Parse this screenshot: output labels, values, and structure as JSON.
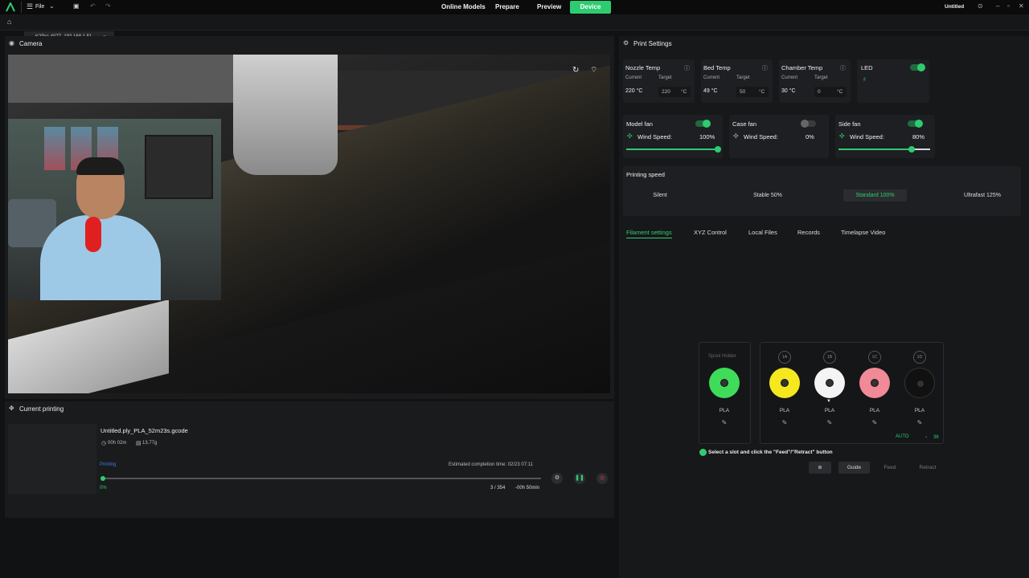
{
  "titlebar": {
    "menu_file": "File",
    "menus": [
      "Online Models",
      "Prepare",
      "Preview"
    ],
    "device": "Device",
    "project_name": "Untitled"
  },
  "tabbar": {
    "file_tab": "K2Pro-4077_192.168.1.51"
  },
  "camera": {
    "title": "Camera"
  },
  "current_printing": {
    "title": "Current printing",
    "filename": "Untitled.ply_PLA_52m23s.gcode",
    "time": "00h 02m",
    "weight": "13.77g",
    "status": "Printing",
    "estimated": "Estimated completion time: 02/23 07:11",
    "progress_percent": 0,
    "progress_label": "0%",
    "layers": "3 / 354",
    "remaining": "-00h 50min"
  },
  "print_settings": {
    "title": "Print Settings",
    "temps": [
      {
        "name": "Nozzle Temp",
        "current_label": "Current",
        "target_label": "Target",
        "current": "220 °C",
        "target": "220",
        "unit": "°C"
      },
      {
        "name": "Bed Temp",
        "current_label": "Current",
        "target_label": "Target",
        "current": "49 °C",
        "target": "50",
        "unit": "°C"
      },
      {
        "name": "Chamber Temp",
        "current_label": "Current",
        "target_label": "Target",
        "current": "30 °C",
        "target": "0",
        "unit": "°C"
      }
    ],
    "led": {
      "name": "LED",
      "on": true
    },
    "fans": [
      {
        "name": "Model fan",
        "on": true,
        "label": "Wind Speed:",
        "value": "100%",
        "level": 100
      },
      {
        "name": "Case fan",
        "on": false,
        "label": "Wind Speed:",
        "value": "0%",
        "level": 0
      },
      {
        "name": "Side fan",
        "on": true,
        "label": "Wind Speed:",
        "value": "80%",
        "level": 80
      }
    ],
    "printing_speed": {
      "title": "Printing speed",
      "options": [
        "Silent",
        "Stable 50%",
        "Standard 100%",
        "Ultrafast 125%"
      ],
      "selected": "Standard 100%"
    }
  },
  "tabs": [
    "Filament settings",
    "XYZ Control",
    "Local Files",
    "Records",
    "Timelapse Video"
  ],
  "filament": {
    "spool_holder_label": "Spool Holder",
    "spool_holder": {
      "material": "PLA",
      "color": "#3fdc5a"
    },
    "slots": [
      {
        "tag": "1A",
        "material": "PLA",
        "color": "#f5e81e"
      },
      {
        "tag": "1B",
        "material": "PLA",
        "color": "#f4f4f4"
      },
      {
        "tag": "1C",
        "material": "PLA",
        "color": "#f08a96"
      },
      {
        "tag": "1D",
        "material": "PLA",
        "color": "#111111"
      }
    ],
    "auto_label": "AUTO",
    "humidity": "36",
    "hint": "Select a slot and click the \"Feed\"/\"Retract\" button",
    "buttons": {
      "guide": "Guide",
      "feed": "Feed",
      "retract": "Retract"
    }
  },
  "colors": {
    "accent": "#2ecc71",
    "background": "#111213",
    "panel": "#1a1b1d"
  }
}
